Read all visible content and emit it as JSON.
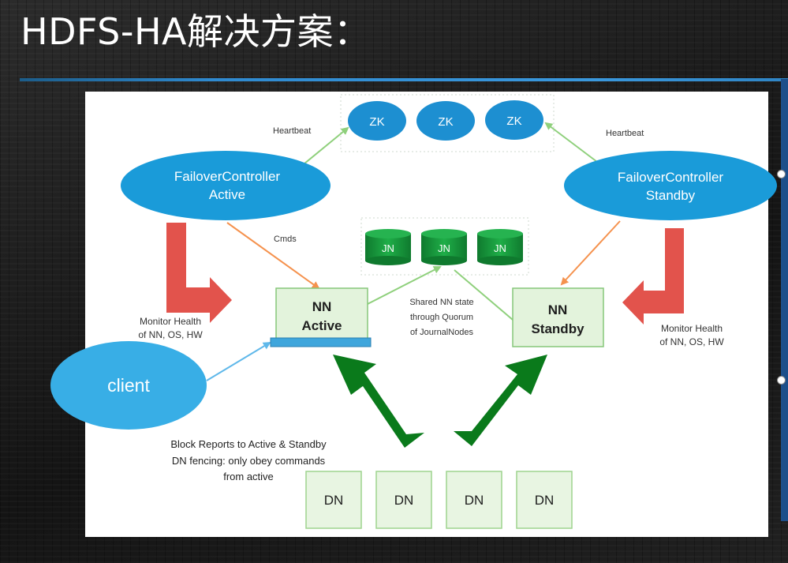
{
  "slide": {
    "title": "HDFS-HA解决方案："
  },
  "diagram": {
    "zk_nodes": [
      "ZK",
      "ZK",
      "ZK"
    ],
    "jn_nodes": [
      "JN",
      "JN",
      "JN"
    ],
    "dn_nodes": [
      "DN",
      "DN",
      "DN",
      "DN"
    ],
    "fc_active": {
      "line1": "FailoverController",
      "line2": "Active"
    },
    "fc_standby": {
      "line1": "FailoverController",
      "line2": "Standby"
    },
    "nn_active": {
      "line1": "NN",
      "line2": "Active"
    },
    "nn_standby": {
      "line1": "NN",
      "line2": "Standby"
    },
    "client": "client",
    "labels": {
      "heartbeat_left": "Heartbeat",
      "heartbeat_right": "Heartbeat",
      "cmds": "Cmds",
      "monitor_left_1": "Monitor Health",
      "monitor_left_2": "of NN, OS, HW",
      "monitor_right_1": "Monitor Health",
      "monitor_right_2": "of NN, OS, HW",
      "shared_1": "Shared NN state",
      "shared_2": "through Quorum",
      "shared_3": "of JournalNodes",
      "block_1": "Block Reports to Active & Standby",
      "block_2": "DN fencing: only obey commands",
      "block_3": "from active"
    },
    "colors": {
      "ellipse_blue": "#1a9bd9",
      "client_blue": "#38aee6",
      "zk_blue": "#1d8fd1",
      "jn_green": "#169a3e",
      "nn_fill": "#e3f3dc",
      "nn_border": "#86c77a",
      "big_arrow_green": "#0a7a1b",
      "red_arrow": "#e2534c",
      "orange_line": "#f5924e",
      "light_green_line": "#8fd07c",
      "client_line": "#5fb8ea",
      "active_bar": "#3fa6dc"
    }
  }
}
